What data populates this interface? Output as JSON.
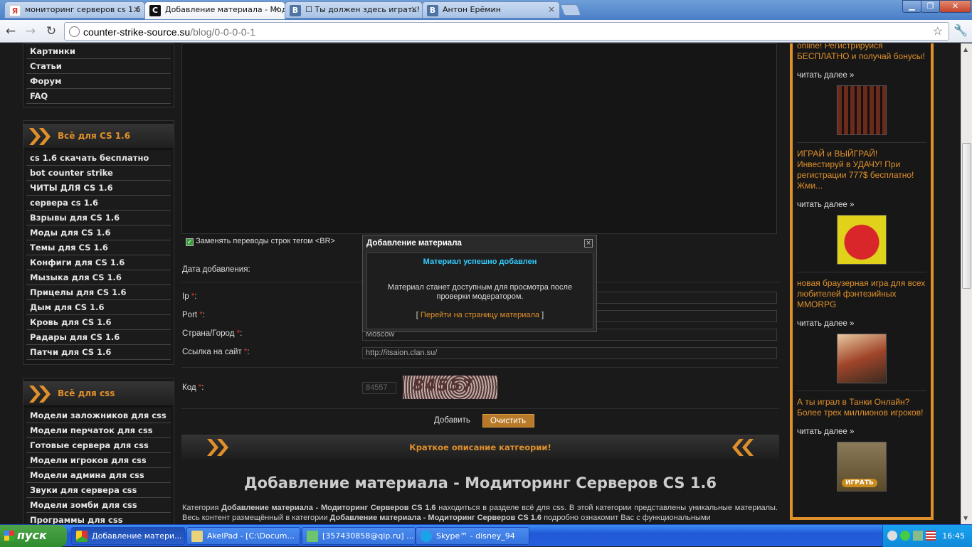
{
  "browser": {
    "tabs": [
      {
        "label": "мониторинг серверов cs 1.6",
        "icon": "yandex-icon",
        "color": "#e2382d"
      },
      {
        "label": "Добавление материала - Мод",
        "icon": "counter-strike-icon",
        "color": "#111111"
      },
      {
        "label": "☐ Ты должен здесь играть!",
        "icon": "vk-icon",
        "color": "#4d74a5"
      },
      {
        "label": "Антон Ерёмин",
        "icon": "vk-icon",
        "color": "#4d74a5"
      }
    ],
    "url_host": "counter-strike-source.su",
    "url_path": "/blog/0-0-0-0-1"
  },
  "sidebar": {
    "top_items": [
      "Картинки",
      "Статьи",
      "Форум",
      "FAQ"
    ],
    "cs16_title": "Всё для CS 1.6",
    "cs16_items": [
      "cs 1.6 скачать бесплатно",
      "bot counter strike",
      "ЧИТЫ ДЛЯ CS 1.6",
      "сервера cs 1.6",
      "Взрывы для CS 1.6",
      "Моды для CS 1.6",
      "Темы для CS 1.6",
      "Конфиги для CS 1.6",
      "Мызыка для CS 1.6",
      "Прицелы для CS 1.6",
      "Дым для CS 1.6",
      "Кровь для CS 1.6",
      "Радары для CS 1.6",
      "Патчи для CS 1.6"
    ],
    "css_title": "Всё для css",
    "css_items": [
      "Модели заложников для css",
      "Модели перчаток для css",
      "Готовые сервера для css",
      "Модели игроков для css",
      "Модели админа для css",
      "Звуки для сервера css",
      "Модели зомби для css",
      "Программы для css"
    ]
  },
  "form": {
    "checkbox_label": "Заменять переводы строк тегом <BR>",
    "date_label": "Дата добавления:",
    "ip_label": "Ip",
    "port_label": "Port",
    "city_label": "Страна/Город",
    "city_value": "Moscow",
    "site_label": "Ссылка на сайт",
    "site_value": "http://itsaion.clan.su/",
    "code_label": "Код",
    "code_value": "84557",
    "captcha_text": "84557",
    "required_mark": "*",
    "colon": ":",
    "add_button": "Добавить",
    "clear_button": "Очистить"
  },
  "category": {
    "bar_title": "Краткое описание катгеории!",
    "page_title": "Добавление материала - Модиторинг Серверов CS 1.6",
    "desc_1": "Категория ",
    "desc_b1": "Добавление материала - Модиторинг Серверов CS 1.6",
    "desc_2": " находиться в разделе всё для css. В этой категории представлены уникальные материалы. Весь контент размещённый в категории ",
    "desc_b2": "Добавление материала - Модиторинг Серверов CS 1.6",
    "desc_3": " подробно ознакомит Вас с функциональными"
  },
  "ads": [
    {
      "text": "online! Регистрируйся БЕСПЛАТНО и получай бонусы!",
      "more": "читать далее »"
    },
    {
      "text": "ИГРАЙ и ВЫЙГРАЙ! Инвестируй в УДАЧУ! При регистрации 777$ бесплатно! Жми...",
      "more": "читать далее »"
    },
    {
      "text": "новая браузерная игра для всех любителей фэнтезийных MMORPG",
      "more": "читать далее »"
    },
    {
      "text": "А ты играл в Танки Онлайн? Более трех миллионов игроков!",
      "more": "читать далее »",
      "badge": "ИГРАТЬ"
    }
  ],
  "modal": {
    "title": "Добавление материала",
    "success": "Материал успешно добавлен",
    "message": "Материал станет доступным для просмотра после проверки модератором.",
    "link_open": "[ ",
    "link_text": "Перейти на страницу материала",
    "link_close": " ]"
  },
  "taskbar": {
    "start": "пуск",
    "tasks": [
      "Добавление матери...",
      "AkelPad - [C:\\Docum...",
      "[357430858@qip.ru] ...",
      "Skype™ - disney_94"
    ],
    "clock": "16:45"
  },
  "colors": {
    "accent": "#e0902a",
    "success": "#33ccff",
    "required": "#dd3333"
  }
}
